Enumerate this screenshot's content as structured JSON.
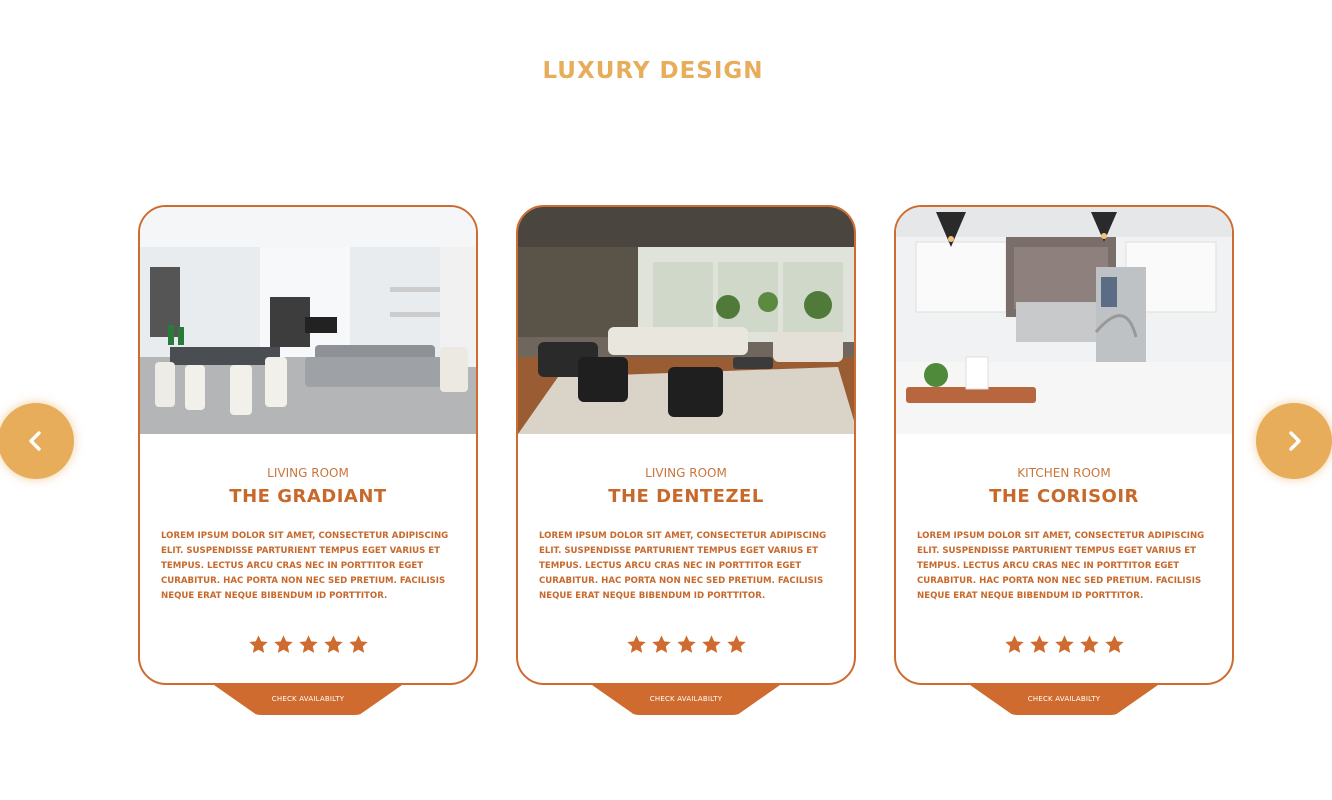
{
  "section": {
    "title": "LUXURY DESIGN"
  },
  "colors": {
    "accent": "#e7ad5b",
    "primary": "#cf6b2e",
    "text": "#c8692c"
  },
  "navigation": {
    "prev_icon": "chevron-left-icon",
    "next_icon": "chevron-right-icon"
  },
  "cards": [
    {
      "image": "living-room-photo",
      "type": "LIVING ROOM",
      "name": "THE GRADIANT",
      "description": "LOREM IPSUM DOLOR SIT AMET, CONSECTETUR ADIPISCING ELIT. SUSPENDISSE PARTURIENT TEMPUS EGET VARIUS ET TEMPUS. LECTUS ARCU CRAS NEC IN PORTTITOR EGET CURABITUR. HAC PORTA NON NEC SED PRETIUM. FACILISIS NEQUE ERAT NEQUE BIBENDUM ID PORTTITOR.",
      "rating": 5,
      "cta": "CHECK AVAILABILTY"
    },
    {
      "image": "living-room-photo",
      "type": "LIVING ROOM",
      "name": "THE DENTEZEL",
      "description": "LOREM IPSUM DOLOR SIT AMET, CONSECTETUR ADIPISCING ELIT. SUSPENDISSE PARTURIENT TEMPUS EGET VARIUS ET TEMPUS. LECTUS ARCU CRAS NEC IN PORTTITOR EGET CURABITUR. HAC PORTA NON NEC SED PRETIUM. FACILISIS NEQUE ERAT NEQUE BIBENDUM ID PORTTITOR.",
      "rating": 5,
      "cta": "CHECK AVAILABILTY"
    },
    {
      "image": "kitchen-photo",
      "type": "KITCHEN ROOM",
      "name": "THE CORISOIR",
      "description": "LOREM IPSUM DOLOR SIT AMET, CONSECTETUR ADIPISCING ELIT. SUSPENDISSE PARTURIENT TEMPUS EGET VARIUS ET TEMPUS. LECTUS ARCU CRAS NEC IN PORTTITOR EGET CURABITUR. HAC PORTA NON NEC SED PRETIUM. FACILISIS NEQUE ERAT NEQUE BIBENDUM ID PORTTITOR.",
      "rating": 5,
      "cta": "CHECK AVAILABILTY"
    }
  ]
}
